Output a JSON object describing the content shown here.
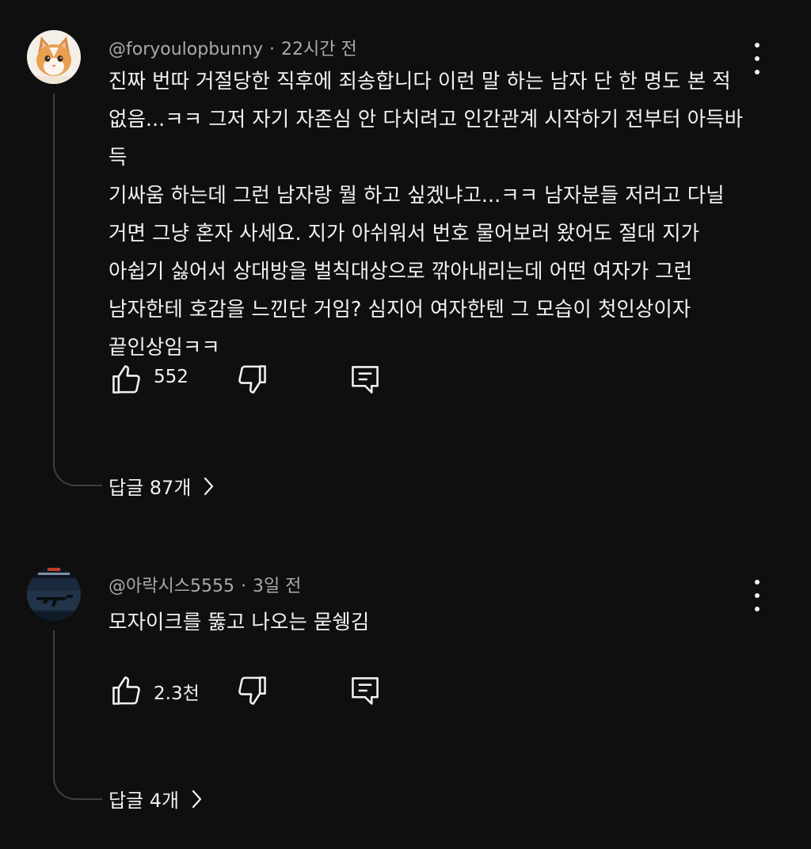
{
  "comments": [
    {
      "handle": "@foryoulopbunny",
      "time": "22시간 전",
      "text": "진짜 번따 거절당한 직후에 죄송합니다 이런 말 하는 남자 단 한 명도 본 적\n없음...ㅋㅋ 그저 자기 자존심 안 다치려고 인간관계 시작하기 전부터 아득바득\n기싸움 하는데 그런 남자랑 뭘 하고 싶겠냐고...ㅋㅋ 남자분들 저러고 다닐\n거면 그냥 혼자 사세요. 지가 아쉬워서 번호 물어보러 왔어도 절대 지가\n아쉽기 싫어서 상대방을 벌칙대상으로 깎아내리는데 어떤 여자가 그런\n남자한테 호감을 느낀단 거임? 심지어 여자한텐 그 모습이 첫인상이자\n끝인상임ㅋㅋ",
      "likes": "552",
      "replies": "답글 87개",
      "avatar": "cat-avatar"
    },
    {
      "handle": "@아락시스5555",
      "time": "3일 전",
      "text": "모자이크를 뚫고 나오는 묻쉥김",
      "likes": "2.3천",
      "replies": "답글 4개",
      "avatar": "game-avatar"
    }
  ],
  "icons": {
    "like": "thumb-up-icon",
    "dislike": "thumb-down-icon",
    "reply": "comment-reply-icon",
    "more": "more-vert-icon",
    "chevron": "chevron-right-icon"
  },
  "colors": {
    "background": "#0f0f0f",
    "text": "#f1f1f1",
    "meta": "#aaaaaa",
    "thread": "#3f3f3f"
  }
}
